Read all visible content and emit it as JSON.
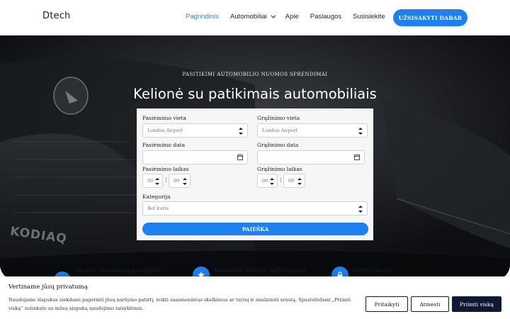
{
  "brand": {
    "name": "Dtech",
    "accent": "#1e7ff0",
    "dark": "#0e1a33"
  },
  "nav": {
    "items": [
      {
        "label": "Pagrindinis",
        "active": true
      },
      {
        "label": "Automobiliai",
        "has_dropdown": true
      },
      {
        "label": "Apie"
      },
      {
        "label": "Paslaugos"
      },
      {
        "label": "Susisiekite"
      }
    ],
    "cta_label": "UŽSISAKYTI DABAR"
  },
  "hero": {
    "kicker": "PASITIKIMI AUTOMOBILIO NUOMOS SPRENDIMAI",
    "title": "Kelionė su patikimais automobiliais",
    "background_text": "KODIAQ"
  },
  "form": {
    "pickup_location": {
      "label": "Pasiėmimo vieta",
      "value": "London Airport"
    },
    "return_location": {
      "label": "Grąžinimo vieta",
      "value": "London Airport"
    },
    "pickup_date": {
      "label": "Pasiėmimo data",
      "value": ""
    },
    "return_date": {
      "label": "Grąžinimo data",
      "value": ""
    },
    "pickup_time": {
      "label": "Pasiėmimo laikas",
      "hour": "00",
      "minute": "00",
      "separator": ":"
    },
    "return_time": {
      "label": "Grąžinimo laikas",
      "hour": "00",
      "minute": "00",
      "separator": ":"
    },
    "category": {
      "label": "Kategorija",
      "value": "Bet kuris"
    },
    "search_label": "PAIEŠKA"
  },
  "features": [
    {
      "icon": "car-icon",
      "label": "Gaukite nemokamą pasiūlymą"
    },
    {
      "icon": "star-icon",
      "label": "Remiantis tikromis apžvalgomis"
    },
    {
      "icon": "lock-icon",
      "label": "Patirtis metai"
    }
  ],
  "cookie": {
    "title": "Vertiname jūsų privatumą",
    "text": "Naudojame slapukus siekdami pagerinti jūsų naršymo patirtį, teikti suasmenintus skelbimus ar turinį ir analizuoti srautą. Spustelėdami „Priimti viską“ sutinkate su mūsų slapukų naudojimo taisyklėmis.",
    "customize_label": "Pritaikyti",
    "reject_label": "Atmesti",
    "accept_label": "Priimti viską"
  }
}
